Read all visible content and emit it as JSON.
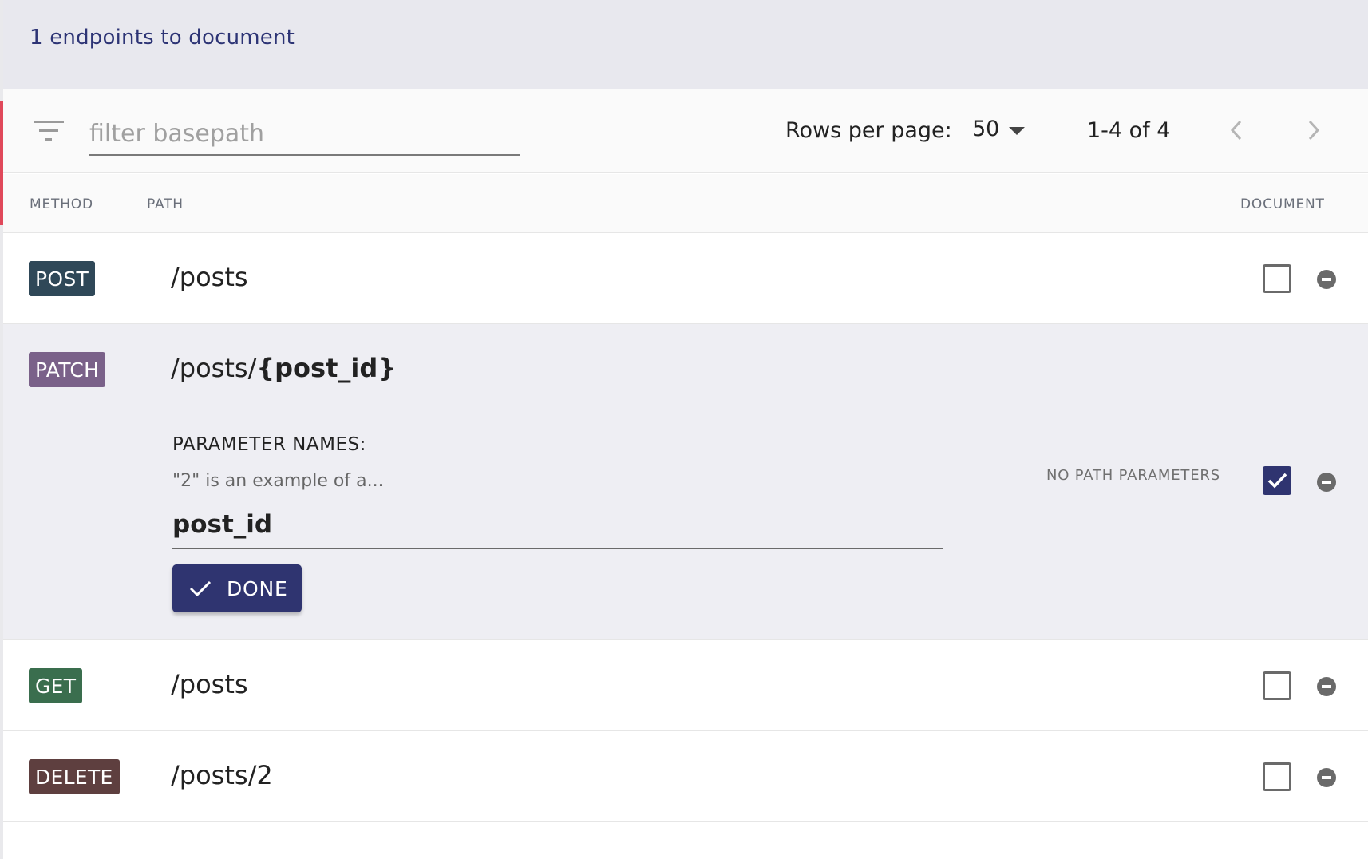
{
  "header": {
    "title": "1 endpoints to document"
  },
  "toolbar": {
    "filter_placeholder": "filter basepath",
    "filter_value": "",
    "rows_per_page_label": "Rows per page:",
    "rows_per_page_value": "50",
    "range_text": "1-4 of 4"
  },
  "columns": {
    "method": "METHOD",
    "path": "PATH",
    "document": "DOCUMENT"
  },
  "rows": [
    {
      "method": "POST",
      "method_color": "#2f4858",
      "path_prefix": "/posts",
      "path_param": "",
      "documented": false
    },
    {
      "method": "PATCH",
      "method_color": "#7a6189",
      "path_prefix": "/posts/",
      "path_param": "{post_id}",
      "documented": true,
      "param_label": "PARAMETER NAMES:",
      "param_hint": "\"2\" is an example of a...",
      "param_value": "post_id",
      "done_label": "DONE",
      "no_path_label": "NO PATH PARAMETERS"
    },
    {
      "method": "GET",
      "method_color": "#3a6e4e",
      "path_prefix": "/posts",
      "path_param": "",
      "documented": false
    },
    {
      "method": "DELETE",
      "method_color": "#5e3f3f",
      "path_prefix": "/posts/2",
      "path_param": "",
      "documented": false
    }
  ],
  "icons": {
    "filter": "filter-icon",
    "dropdown": "caret-down-icon",
    "prev": "chevron-left-icon",
    "next": "chevron-right-icon",
    "remove": "minus-circle-icon",
    "check": "check-icon"
  }
}
